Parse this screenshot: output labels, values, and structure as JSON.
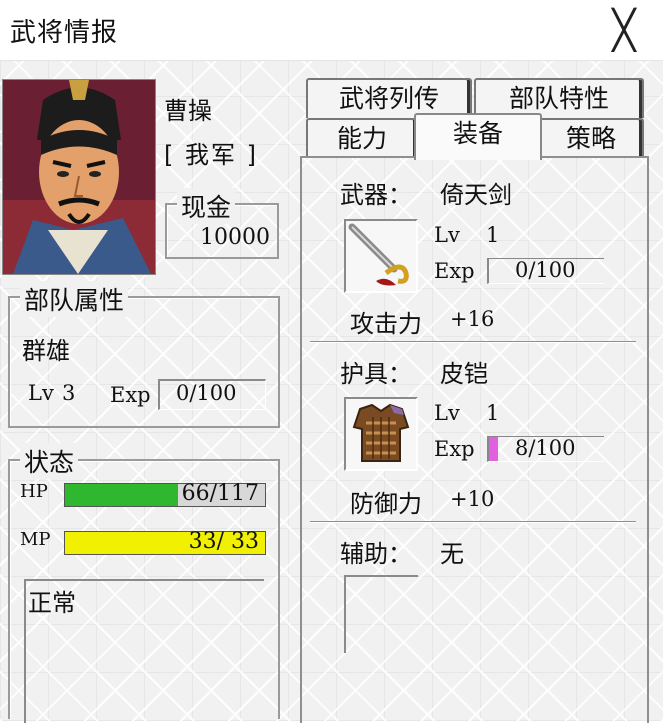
{
  "window": {
    "title": "武将情报",
    "close_glyph": "╳"
  },
  "general": {
    "name": "曹操",
    "faction": "[ 我军 ]",
    "money_label": "现金",
    "money": "10000"
  },
  "unit": {
    "legend": "部队属性",
    "type": "群雄",
    "lv_label": "Lv",
    "lv": "3",
    "exp_label": "Exp",
    "exp": "0/100"
  },
  "status": {
    "legend": "状态",
    "hp_label": "HP",
    "hp_text": "66/117",
    "hp_ratio": 0.564,
    "mp_label": "MP",
    "mp_text": "33/ 33",
    "mp_ratio": 1.0,
    "condition": "正常",
    "hp_color": "#2fb82f",
    "mp_color": "#f0f000"
  },
  "tabs": {
    "top": [
      "武将列传",
      "部队特性"
    ],
    "bottom": [
      "能力",
      "装备",
      "策略"
    ],
    "active": "装备"
  },
  "equipment": {
    "weapon": {
      "slot_label": "武器：",
      "name": "倚天剑",
      "icon": "sword-icon",
      "lv_label": "Lv",
      "lv": "1",
      "exp_label": "Exp",
      "exp": "0/100",
      "exp_ratio": 0.0,
      "stat_label": "攻击力",
      "stat_value": "+16"
    },
    "armor": {
      "slot_label": "护具：",
      "name": "皮铠",
      "icon": "armor-icon",
      "lv_label": "Lv",
      "lv": "1",
      "exp_label": "Exp",
      "exp": "8/100",
      "exp_ratio": 0.08,
      "stat_label": "防御力",
      "stat_value": "+10"
    },
    "accessory": {
      "slot_label": "辅助：",
      "name": "无"
    }
  },
  "colors": {
    "exp_fill": "#e060e0",
    "frame": "#8f8f8f"
  }
}
